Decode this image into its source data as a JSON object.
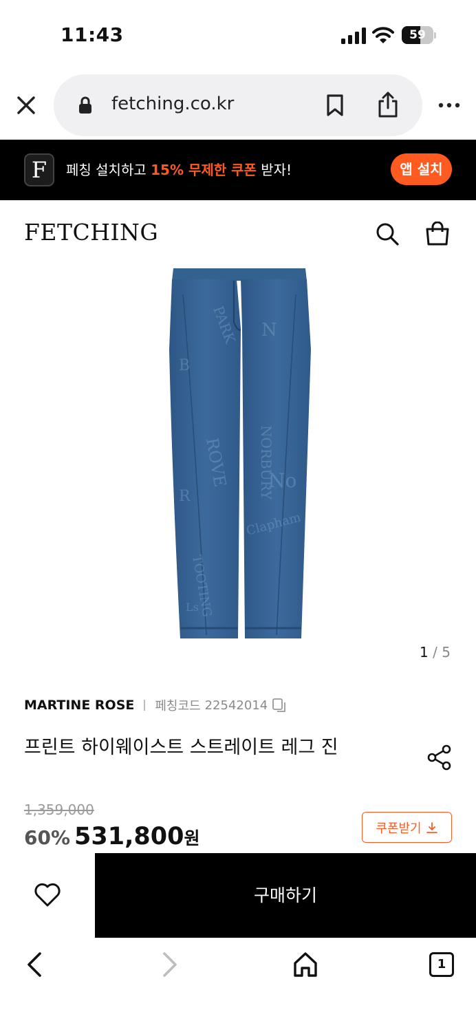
{
  "status_bar": {
    "time": "11:43",
    "battery_level": "59",
    "icons": [
      "cellular-signal-icon",
      "wifi-icon",
      "battery-icon"
    ]
  },
  "browser": {
    "url": "fetching.co.kr",
    "icons": [
      "close-icon",
      "lock-icon",
      "bookmark-icon",
      "share-icon",
      "more-icon"
    ]
  },
  "app_banner": {
    "logo_letter": "F",
    "message_prefix": "페칭 설치하고 ",
    "message_highlight": "15% 무제한 쿠폰",
    "message_suffix": " 받자!",
    "install_label": "앱 설치",
    "accent_color": "#ff5a1f"
  },
  "header": {
    "brand": "FETCHING",
    "icons": [
      "search-icon",
      "shopping-bag-icon"
    ]
  },
  "gallery": {
    "current": "1",
    "separator": " / ",
    "total": "5"
  },
  "product": {
    "brand": "MARTINE ROSE",
    "code_label": "페칭코드",
    "code": "22542014",
    "title": "프린트 하이웨이스트 스트레이트 레그 진",
    "original_price": "1,359,000",
    "discount": "60%",
    "sale_price": "531,800",
    "currency": "원",
    "coupon_label": "쿠폰받기"
  },
  "purchase_bar": {
    "buy_label": "구매하기",
    "icons": [
      "heart-icon"
    ]
  },
  "toolbar": {
    "tab_count": "1",
    "icons": [
      "back-icon",
      "forward-icon",
      "home-icon",
      "tabs-icon"
    ]
  }
}
